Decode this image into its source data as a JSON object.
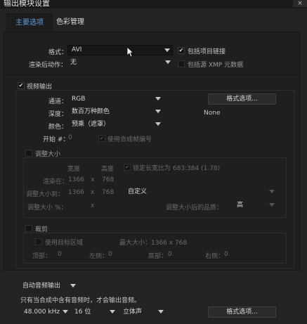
{
  "window": {
    "title": "输出模块设置",
    "close_icon": "×"
  },
  "tabs": [
    {
      "label": "主要选项",
      "active": true
    },
    {
      "label": "色彩管理",
      "active": false
    }
  ],
  "main": {
    "format_label": "格式：",
    "format_value": "AVI",
    "post_render_label": "渲染后动作：",
    "post_render_value": "无",
    "include_project_link": {
      "label": "包括项目链接",
      "checked": true
    },
    "include_xmp": {
      "label": "包括源 XMP 元数据",
      "checked": false
    }
  },
  "video": {
    "section_label": "视频输出",
    "checked": true,
    "channels_label": "通道：",
    "channels_value": "RGB",
    "depth_label": "深度：",
    "depth_value": "数百万种颜色",
    "color_label": "颜色：",
    "color_value": "预乘（遮罩）",
    "start_label": "开始 #：",
    "start_value": "0",
    "use_comp_frame": {
      "label": "使用合成帧编号",
      "checked": true
    },
    "format_options_button": "格式选项...",
    "codec_value": "None"
  },
  "resize": {
    "section_label": "调整大小",
    "checked": false,
    "width_header": "宽度",
    "height_header": "高度",
    "lock_aspect": {
      "label": "锁定长宽比为 683:384 (1.78)",
      "checked": true
    },
    "render_at_label": "渲染在：",
    "render_at_w": "1366",
    "render_at_x": "x",
    "render_at_h": "768",
    "resize_to_label": "调整大小到：",
    "resize_to_w": "1366",
    "resize_to_x": "x",
    "resize_to_h": "768",
    "preset_value": "自定义",
    "resize_pct_label": "调整大小 %：",
    "resize_pct_x": "x",
    "quality_label": "调整大小后的品质：",
    "quality_value": "高"
  },
  "crop": {
    "section_label": "裁剪",
    "checked": false,
    "use_roi": {
      "label": "使用目标区域",
      "checked": false
    },
    "max_size": "最大大小：1366 x 768",
    "top_label": "顶部：",
    "top_value": "0",
    "left_label": "左侧：",
    "left_value": "0",
    "bottom_label": "底部：",
    "bottom_value": "0",
    "right_label": "右侧：",
    "right_value": "0"
  },
  "audio": {
    "mode_value": "自动音频输出",
    "note": "只有当合成中含有音频时，才会输出音频。",
    "sample_rate_value": "48.000 kHz",
    "bits_value": "16 位",
    "channels_value": "立体声",
    "format_options_button": "格式选项..."
  },
  "icons": {
    "check": "✔",
    "cursor": "mouse-pointer-icon",
    "dropdown": "chevron-down-icon"
  }
}
